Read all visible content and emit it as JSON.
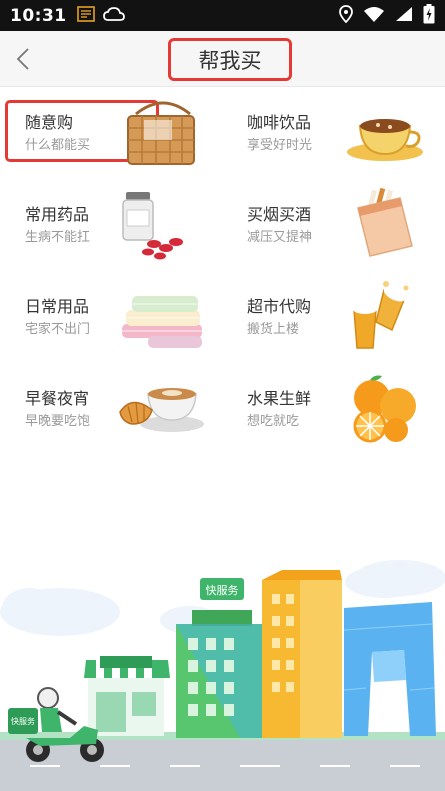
{
  "status_bar": {
    "time": "10:31",
    "icons": [
      "notes-icon",
      "cloud-icon",
      "location-icon",
      "wifi-icon",
      "signal-icon",
      "battery-icon"
    ]
  },
  "header": {
    "title": "帮我买",
    "back_icon": "chevron-left-icon"
  },
  "categories": [
    {
      "name": "随意购",
      "desc": "什么都能买",
      "icon": "basket-icon"
    },
    {
      "name": "咖啡饮品",
      "desc": "享受好时光",
      "icon": "coffee-icon"
    },
    {
      "name": "常用药品",
      "desc": "生病不能扛",
      "icon": "medicine-icon"
    },
    {
      "name": "买烟买酒",
      "desc": "减压又提神",
      "icon": "cigarettes-icon"
    },
    {
      "name": "日常用品",
      "desc": "宅家不出门",
      "icon": "towels-icon"
    },
    {
      "name": "超市代购",
      "desc": "搬货上楼",
      "icon": "beer-icon"
    },
    {
      "name": "早餐夜宵",
      "desc": "早晚要吃饱",
      "icon": "croissant-coffee-icon"
    },
    {
      "name": "水果生鲜",
      "desc": "想吃就吃",
      "icon": "orange-icon"
    }
  ],
  "illustration": {
    "building_sign": "快服务",
    "scooter_box": "快服务"
  },
  "colors": {
    "highlight": "#e53935",
    "status_bar": "#121212",
    "nav_bg": "#f6f6f6"
  }
}
